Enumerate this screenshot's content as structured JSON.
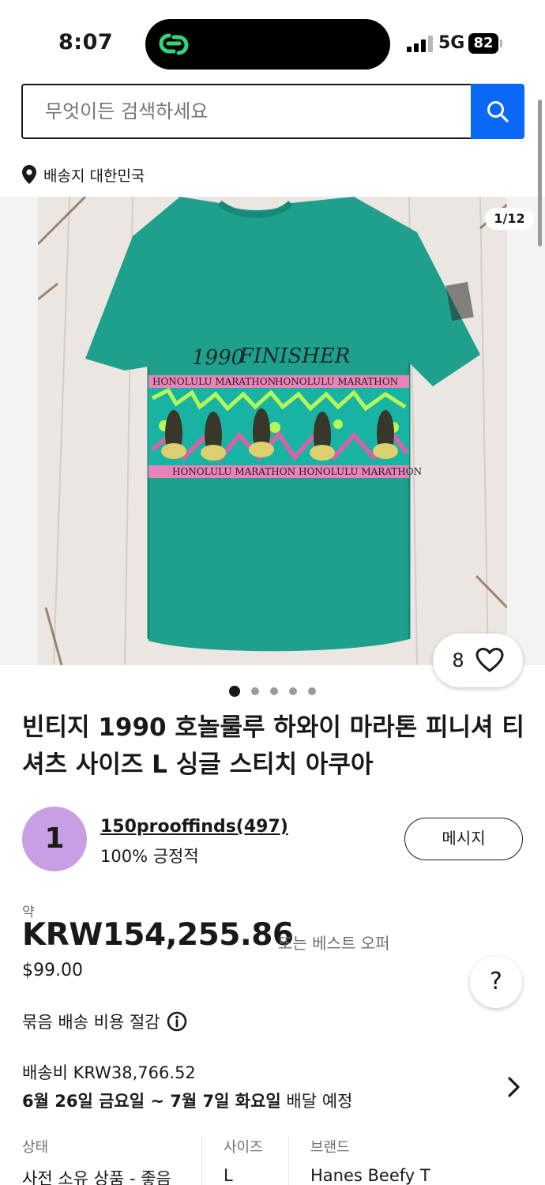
{
  "status": {
    "time": "8:07",
    "network": "5G",
    "battery": "82"
  },
  "search": {
    "placeholder": "무엇이든 검색하세요"
  },
  "location": {
    "label": "배송지 대한민국"
  },
  "gallery": {
    "counter": "1/12",
    "watch_count": "8",
    "dots_total": 5,
    "dots_active": 1,
    "print": {
      "year": "1990",
      "word": "FINISHER",
      "band": "HONOLULU MARATHON"
    }
  },
  "listing": {
    "title": "빈티지 1990 호놀룰루 하와이 마라톤 피니셔 티셔츠 사이즈 L 싱글 스티치 아쿠아"
  },
  "seller": {
    "initial": "1",
    "name": "150prooffinds(497)",
    "feedback": "100% 긍정적",
    "message_label": "메시지"
  },
  "price": {
    "approx_label": "약",
    "amount": "KRW154,255.86",
    "best_offer": "또는 베스트 오퍼",
    "usd": "$99.00"
  },
  "shipping": {
    "combine": "묶음 배송 비용 절감",
    "cost": "배송비 KRW38,766.52",
    "delivery_bold_1": "6월 26일 금요일",
    "delivery_sep": " ~ ",
    "delivery_bold_2": "7월 7일 화요일",
    "delivery_suffix": " 배달 예정"
  },
  "specs": [
    {
      "label": "상태",
      "value": "사전 소유 상품 - 좋음"
    },
    {
      "label": "사이즈",
      "value": "L"
    },
    {
      "label": "브랜드",
      "value": "Hanes Beefy T"
    }
  ],
  "help": {
    "label": "?"
  },
  "colors": {
    "accent": "#0968f6",
    "shirt": "#1ea08c",
    "avatar": "#c89fe3",
    "text": "#191919",
    "muted": "#707070"
  }
}
